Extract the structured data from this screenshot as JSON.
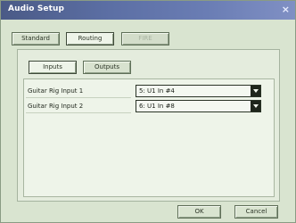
{
  "window": {
    "title": "Audio Setup"
  },
  "tabs": [
    {
      "label": "Standard"
    },
    {
      "label": "Routing"
    },
    {
      "label": "FIRE"
    }
  ],
  "subtabs": [
    {
      "label": "Inputs"
    },
    {
      "label": "Outputs"
    }
  ],
  "routing_rows": [
    {
      "name": "Guitar Rig Input 1",
      "value": "5: U1 In #4"
    },
    {
      "name": "Guitar Rig Input 2",
      "value": "6: U1 In #8"
    }
  ],
  "buttons": {
    "ok": "OK",
    "cancel": "Cancel"
  },
  "colors": {
    "titlebar": "#5b6ea3",
    "background": "#d9e4d0"
  }
}
